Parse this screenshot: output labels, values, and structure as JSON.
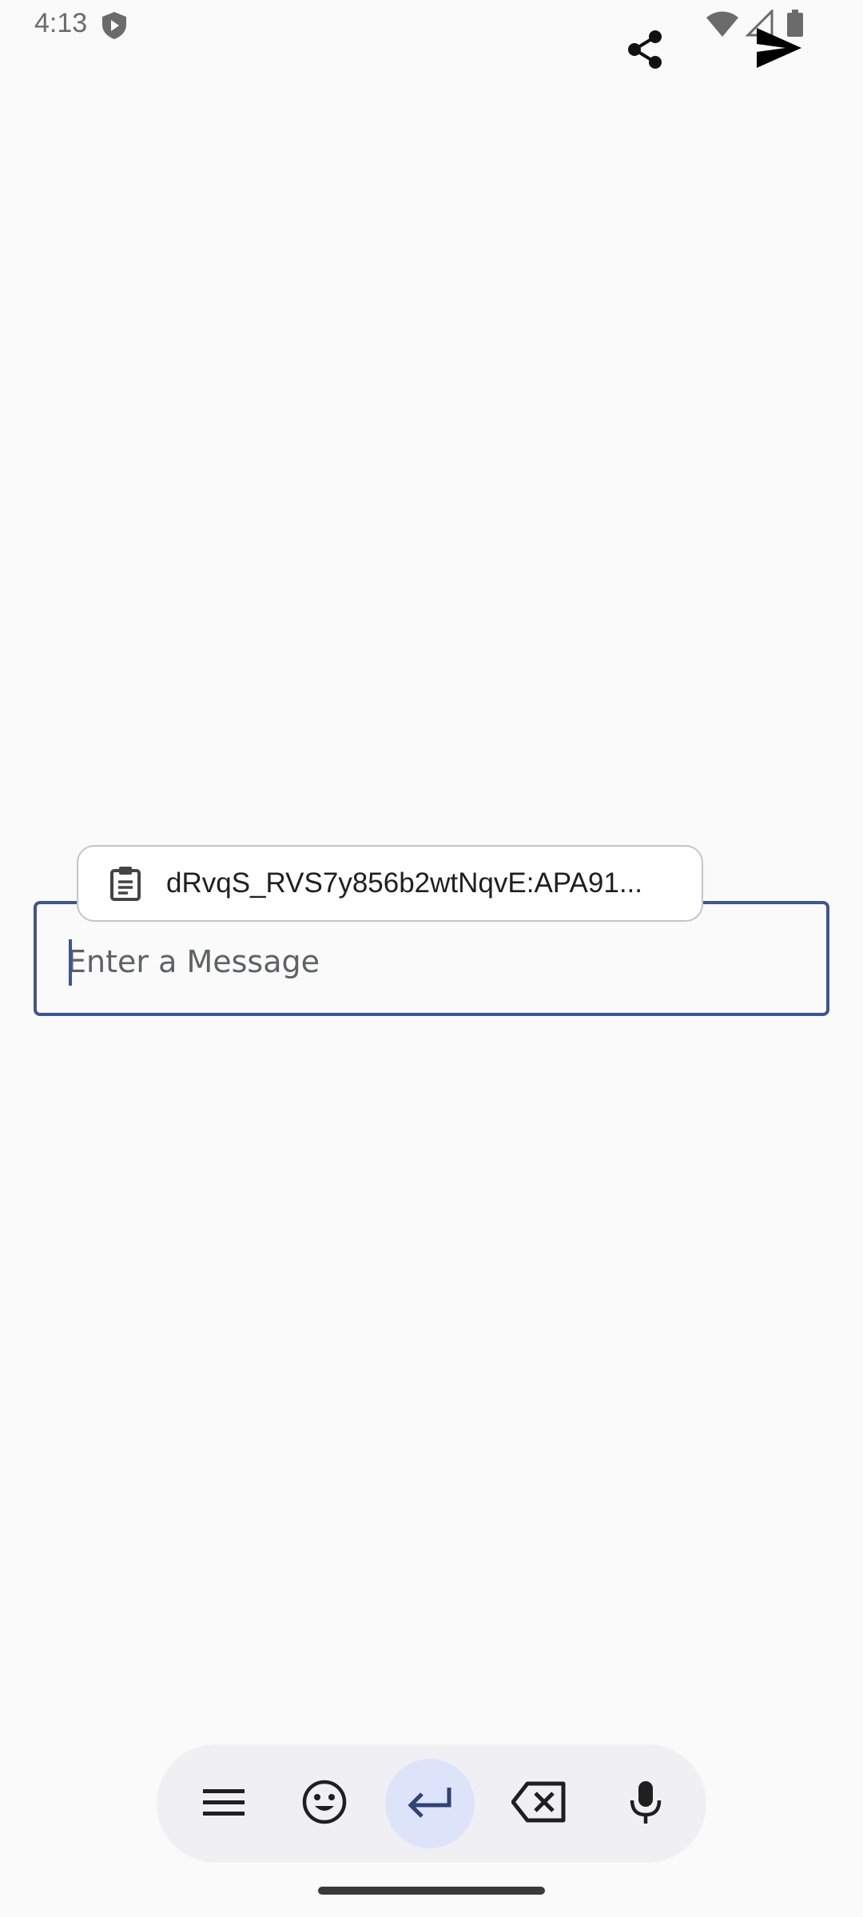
{
  "status_bar": {
    "time": "4:13",
    "icons": [
      "shield-icon",
      "wifi-icon",
      "signal-icon",
      "battery-icon"
    ]
  },
  "toolbar": {
    "icons": [
      "share-icon",
      "send-icon"
    ]
  },
  "clipboard_suggestion": {
    "icon": "clipboard-icon",
    "text": "dRvqS_RVS7y856b2wtNqvE:APA91..."
  },
  "message_input": {
    "placeholder": "Enter a Message",
    "value": ""
  },
  "keyboard_toolbar": {
    "buttons": [
      "menu-icon",
      "emoji-icon",
      "enter-icon",
      "backspace-icon",
      "mic-icon"
    ],
    "active": "enter-icon"
  },
  "colors": {
    "accent": "#3f5590",
    "background": "#fafafa",
    "active_button": "#dde3f8"
  }
}
